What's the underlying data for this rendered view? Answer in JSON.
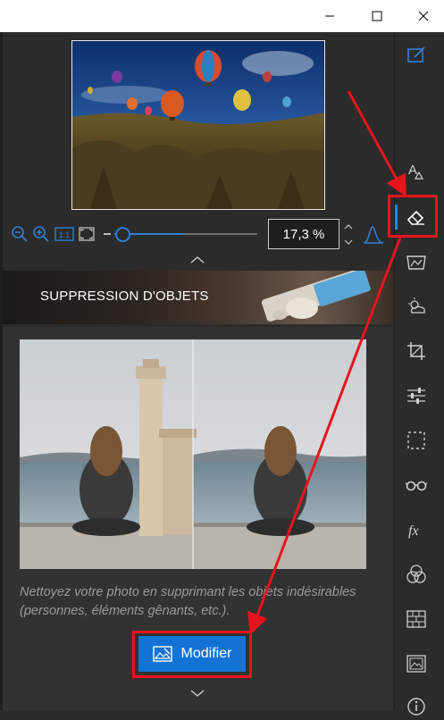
{
  "window": {
    "minimize_icon": "minimize-icon",
    "maximize_icon": "maximize-icon",
    "close_icon": "close-icon"
  },
  "zoom": {
    "value": "17,3 %",
    "slider_level_fraction": 0.48
  },
  "section": {
    "title": "SUPPRESSION D'OBJETS",
    "description": "Nettoyez votre photo en supprimant les objets indésirables (personnes, éléments gênants, etc.).",
    "button_label": "Modifier"
  },
  "colors": {
    "accent": "#1273d4",
    "highlight": "#e8141b",
    "panel": "#2b2b2b"
  },
  "toolbar_icons": [
    "edit-icon",
    "text-icon",
    "eraser-icon",
    "perspective-icon",
    "weather-icon",
    "crop-icon",
    "adjust-icon",
    "selection-icon",
    "glasses-icon",
    "fx-icon",
    "color-circles-icon",
    "texture-icon",
    "frame-icon",
    "info-icon"
  ]
}
